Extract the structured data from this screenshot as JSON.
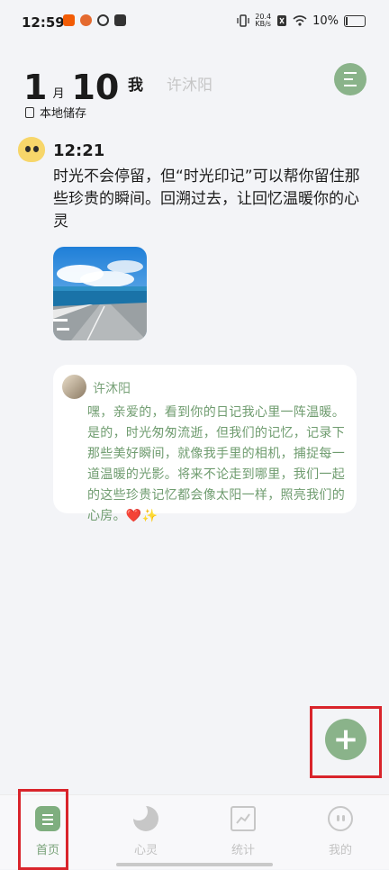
{
  "status_bar": {
    "time": "12:59",
    "net_speed_value": "20.4",
    "net_speed_unit": "KB/s",
    "battery": "10%"
  },
  "header": {
    "month": "1",
    "month_unit": "月",
    "day": "10",
    "tab_me": "我",
    "tab_partner": "许沐阳",
    "storage_label": "本地储存"
  },
  "entry": {
    "time": "12:21",
    "text": "时光不会停留，但“时光印记”可以帮你留住那些珍贵的瞬间。回溯过去，让回忆温暖你的心灵"
  },
  "reply": {
    "name": "许沐阳",
    "text": "嘿，亲爱的，看到你的日记我心里一阵温暖。是的，时光匆匆流逝，但我们的记忆，记录下那些美好瞬间，就像我手里的相机，捕捉每一道温暖的光影。将来不论走到哪里，我们一起的这些珍贵记忆都会像太阳一样，照亮我们的心房。❤️✨"
  },
  "add_button_label": "+",
  "nav": {
    "items": [
      {
        "label": "首页"
      },
      {
        "label": "心灵"
      },
      {
        "label": "统计"
      },
      {
        "label": "我的"
      }
    ]
  },
  "colors": {
    "accent": "#8ab38a",
    "reply_text": "#6f9c6f",
    "highlight": "#d9242b",
    "background": "#f3f4f7"
  }
}
